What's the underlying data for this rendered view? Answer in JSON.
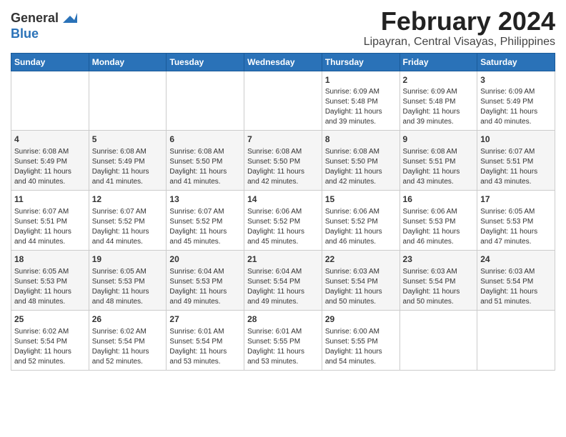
{
  "header": {
    "logo_line1": "General",
    "logo_line2": "Blue",
    "month_year": "February 2024",
    "location": "Lipayran, Central Visayas, Philippines"
  },
  "weekdays": [
    "Sunday",
    "Monday",
    "Tuesday",
    "Wednesday",
    "Thursday",
    "Friday",
    "Saturday"
  ],
  "weeks": [
    [
      {
        "day": "",
        "info": ""
      },
      {
        "day": "",
        "info": ""
      },
      {
        "day": "",
        "info": ""
      },
      {
        "day": "",
        "info": ""
      },
      {
        "day": "1",
        "info": "Sunrise: 6:09 AM\nSunset: 5:48 PM\nDaylight: 11 hours\nand 39 minutes."
      },
      {
        "day": "2",
        "info": "Sunrise: 6:09 AM\nSunset: 5:48 PM\nDaylight: 11 hours\nand 39 minutes."
      },
      {
        "day": "3",
        "info": "Sunrise: 6:09 AM\nSunset: 5:49 PM\nDaylight: 11 hours\nand 40 minutes."
      }
    ],
    [
      {
        "day": "4",
        "info": "Sunrise: 6:08 AM\nSunset: 5:49 PM\nDaylight: 11 hours\nand 40 minutes."
      },
      {
        "day": "5",
        "info": "Sunrise: 6:08 AM\nSunset: 5:49 PM\nDaylight: 11 hours\nand 41 minutes."
      },
      {
        "day": "6",
        "info": "Sunrise: 6:08 AM\nSunset: 5:50 PM\nDaylight: 11 hours\nand 41 minutes."
      },
      {
        "day": "7",
        "info": "Sunrise: 6:08 AM\nSunset: 5:50 PM\nDaylight: 11 hours\nand 42 minutes."
      },
      {
        "day": "8",
        "info": "Sunrise: 6:08 AM\nSunset: 5:50 PM\nDaylight: 11 hours\nand 42 minutes."
      },
      {
        "day": "9",
        "info": "Sunrise: 6:08 AM\nSunset: 5:51 PM\nDaylight: 11 hours\nand 43 minutes."
      },
      {
        "day": "10",
        "info": "Sunrise: 6:07 AM\nSunset: 5:51 PM\nDaylight: 11 hours\nand 43 minutes."
      }
    ],
    [
      {
        "day": "11",
        "info": "Sunrise: 6:07 AM\nSunset: 5:51 PM\nDaylight: 11 hours\nand 44 minutes."
      },
      {
        "day": "12",
        "info": "Sunrise: 6:07 AM\nSunset: 5:52 PM\nDaylight: 11 hours\nand 44 minutes."
      },
      {
        "day": "13",
        "info": "Sunrise: 6:07 AM\nSunset: 5:52 PM\nDaylight: 11 hours\nand 45 minutes."
      },
      {
        "day": "14",
        "info": "Sunrise: 6:06 AM\nSunset: 5:52 PM\nDaylight: 11 hours\nand 45 minutes."
      },
      {
        "day": "15",
        "info": "Sunrise: 6:06 AM\nSunset: 5:52 PM\nDaylight: 11 hours\nand 46 minutes."
      },
      {
        "day": "16",
        "info": "Sunrise: 6:06 AM\nSunset: 5:53 PM\nDaylight: 11 hours\nand 46 minutes."
      },
      {
        "day": "17",
        "info": "Sunrise: 6:05 AM\nSunset: 5:53 PM\nDaylight: 11 hours\nand 47 minutes."
      }
    ],
    [
      {
        "day": "18",
        "info": "Sunrise: 6:05 AM\nSunset: 5:53 PM\nDaylight: 11 hours\nand 48 minutes."
      },
      {
        "day": "19",
        "info": "Sunrise: 6:05 AM\nSunset: 5:53 PM\nDaylight: 11 hours\nand 48 minutes."
      },
      {
        "day": "20",
        "info": "Sunrise: 6:04 AM\nSunset: 5:53 PM\nDaylight: 11 hours\nand 49 minutes."
      },
      {
        "day": "21",
        "info": "Sunrise: 6:04 AM\nSunset: 5:54 PM\nDaylight: 11 hours\nand 49 minutes."
      },
      {
        "day": "22",
        "info": "Sunrise: 6:03 AM\nSunset: 5:54 PM\nDaylight: 11 hours\nand 50 minutes."
      },
      {
        "day": "23",
        "info": "Sunrise: 6:03 AM\nSunset: 5:54 PM\nDaylight: 11 hours\nand 50 minutes."
      },
      {
        "day": "24",
        "info": "Sunrise: 6:03 AM\nSunset: 5:54 PM\nDaylight: 11 hours\nand 51 minutes."
      }
    ],
    [
      {
        "day": "25",
        "info": "Sunrise: 6:02 AM\nSunset: 5:54 PM\nDaylight: 11 hours\nand 52 minutes."
      },
      {
        "day": "26",
        "info": "Sunrise: 6:02 AM\nSunset: 5:54 PM\nDaylight: 11 hours\nand 52 minutes."
      },
      {
        "day": "27",
        "info": "Sunrise: 6:01 AM\nSunset: 5:54 PM\nDaylight: 11 hours\nand 53 minutes."
      },
      {
        "day": "28",
        "info": "Sunrise: 6:01 AM\nSunset: 5:55 PM\nDaylight: 11 hours\nand 53 minutes."
      },
      {
        "day": "29",
        "info": "Sunrise: 6:00 AM\nSunset: 5:55 PM\nDaylight: 11 hours\nand 54 minutes."
      },
      {
        "day": "",
        "info": ""
      },
      {
        "day": "",
        "info": ""
      }
    ]
  ]
}
